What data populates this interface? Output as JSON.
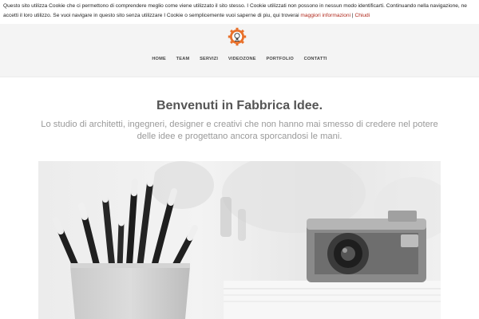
{
  "cookie_banner": {
    "text": "Questo sito utilizza Cookie che ci permettono di comprendere meglio come viene utilizzato il sito stesso. I Cookie utilizzati non possono in nessun modo identificarti. Continuando nella navigazione, ne accetti il loro utilizzo. Se vuoi navigare in questo sito senza utilizzare I Cookie o semplicemente vuoi saperne di piu, qui troverai ",
    "more_info_label": "maggiori informazioni",
    "separator": " | ",
    "close_label": "Chiudi"
  },
  "logo": {
    "icon": "gear-lightbulb-logo",
    "color": "#e8702a"
  },
  "nav": {
    "items": [
      {
        "label": "HOME"
      },
      {
        "label": "TEAM"
      },
      {
        "label": "SERVIZI"
      },
      {
        "label": "VIDEOZONE"
      },
      {
        "label": "PORTFOLIO"
      },
      {
        "label": "CONTATTI"
      }
    ]
  },
  "hero": {
    "title": "Benvenuti in Fabbrica Idee.",
    "subtitle": "Lo studio di architetti, ingegneri, designer e creativi che non hanno mai smesso di credere nel potere delle idee e progettano ancora sporcandosi le mani."
  },
  "colors": {
    "link": "#b0281c",
    "header_bg": "#f4f4f4",
    "accent": "#e8702a"
  }
}
